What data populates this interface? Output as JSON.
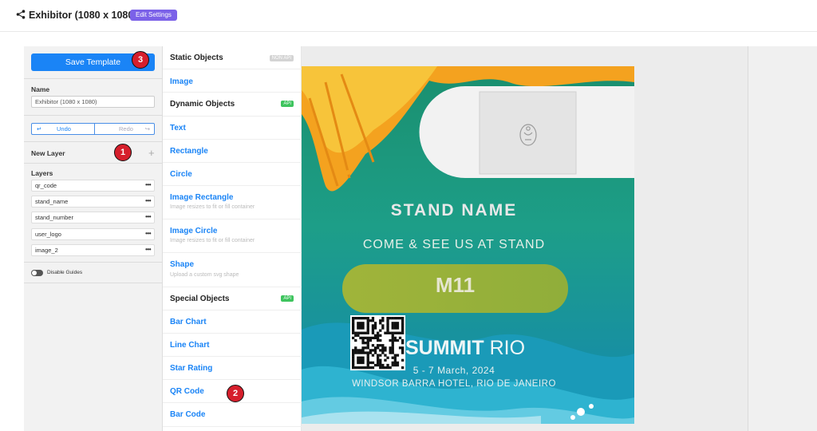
{
  "header": {
    "title": "Exhibitor (1080 x 1080)",
    "edit_label": "Edit Settings"
  },
  "panel": {
    "save_label": "Save Template",
    "name_label": "Name",
    "name_value": "Exhibitor (1080 x 1080)",
    "undo_label": "Undo",
    "redo_label": "Redo",
    "new_layer_label": "New Layer",
    "layers_label": "Layers",
    "layers": [
      "qr_code",
      "stand_name",
      "stand_number",
      "user_logo",
      "image_2"
    ],
    "guides_label": "Disable Guides"
  },
  "badges": {
    "b1": "1",
    "b2": "2",
    "b3": "3"
  },
  "menu": {
    "static_header": "Static Objects",
    "static_tag": "NON API",
    "image": "Image",
    "dynamic_header": "Dynamic Objects",
    "dynamic_tag": "API",
    "text": "Text",
    "rectangle": "Rectangle",
    "circle": "Circle",
    "image_rect": "Image Rectangle",
    "image_rect_desc": "Image resizes to fit or fill container",
    "image_circle": "Image Circle",
    "image_circle_desc": "Image resizes to fit or fill container",
    "shape": "Shape",
    "shape_desc": "Upload a custom svg shape",
    "special_header": "Special Objects",
    "special_tag": "API",
    "bar_chart": "Bar Chart",
    "line_chart": "Line Chart",
    "star_rating": "Star Rating",
    "qr_code": "QR Code",
    "bar_code": "Bar Code"
  },
  "canvas": {
    "stand_name": "STAND NAME",
    "come_see": "COME & SEE US AT STAND",
    "stand_number": "M11",
    "summit_bold": "SUMMIT",
    "summit_light": "RIO",
    "dates": "5 - 7 March, 2024",
    "venue": "WINDSOR BARRA HOTEL, RIO DE JANEIRO",
    "colors": {
      "teal_top": "#f39a1e",
      "teal": "#17a68a",
      "pill": "#9ab63a",
      "accent": "#1a84f6"
    }
  }
}
